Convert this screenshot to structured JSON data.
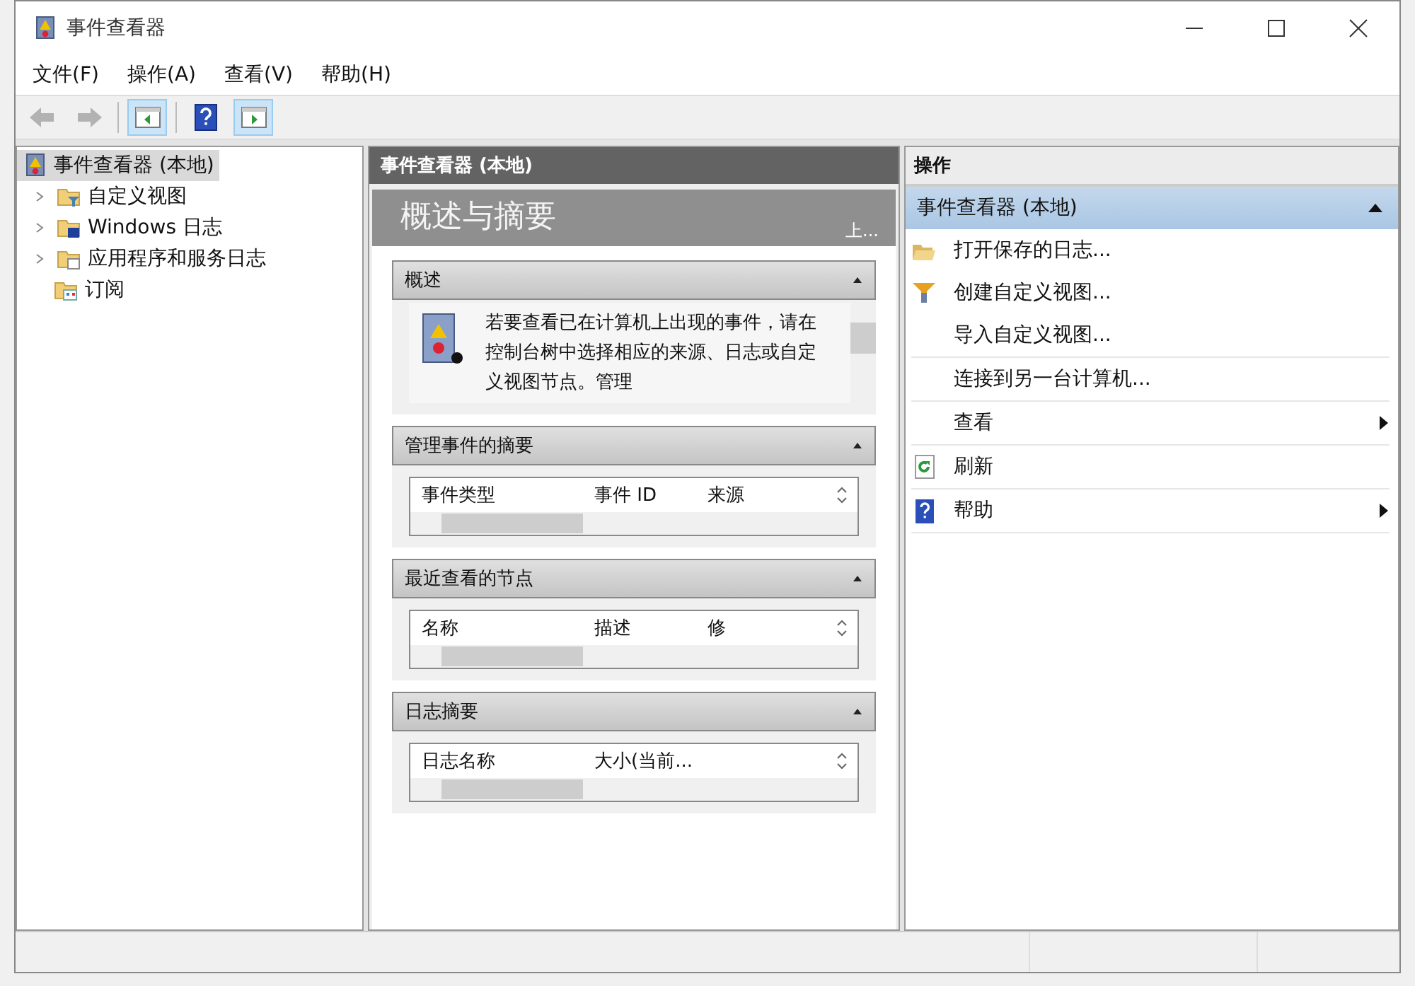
{
  "window": {
    "title": "事件查看器"
  },
  "menu": [
    {
      "label": "文件(F)"
    },
    {
      "label": "操作(A)"
    },
    {
      "label": "查看(V)"
    },
    {
      "label": "帮助(H)"
    }
  ],
  "toolbar": [
    {
      "kind": "back",
      "disabled": true,
      "pressed": false
    },
    {
      "kind": "forward",
      "disabled": true,
      "pressed": false
    },
    {
      "kind": "tree-pane",
      "disabled": false,
      "pressed": true
    },
    {
      "kind": "help",
      "disabled": false,
      "pressed": false
    },
    {
      "kind": "action-pane",
      "disabled": false,
      "pressed": true
    }
  ],
  "tree": [
    {
      "label": "事件查看器 (本地)",
      "kind": "viewer",
      "selected": true,
      "expanded": true,
      "children": [
        {
          "label": "自定义视图",
          "kind": "custom-views",
          "selected": false,
          "expanded": false
        },
        {
          "label": "Windows 日志",
          "kind": "windows-logs",
          "selected": false,
          "expanded": false
        },
        {
          "label": "应用程序和服务日志",
          "kind": "app-logs",
          "selected": false,
          "expanded": false
        },
        {
          "label": "订阅",
          "kind": "subscriptions",
          "selected": false
        }
      ]
    }
  ],
  "center": {
    "header": "事件查看器 (本地)",
    "title": "概述与摘要",
    "corner": "上...",
    "sections": [
      {
        "title": "概述",
        "kind": "text",
        "expanded": true,
        "text": "若要查看已在计算机上出现的事件，请在控制台树中选择相应的来源、日志或自定义视图节点。管理"
      },
      {
        "title": "管理事件的摘要",
        "kind": "table",
        "expanded": true,
        "columns": [
          "事件类型",
          "事件 ID",
          "来源"
        ]
      },
      {
        "title": "最近查看的节点",
        "kind": "table",
        "expanded": true,
        "columns": [
          "名称",
          "描述",
          "修"
        ]
      },
      {
        "title": "日志摘要",
        "kind": "table",
        "expanded": true,
        "columns": [
          "日志名称",
          "大小(当前..."
        ]
      }
    ]
  },
  "actions": {
    "header": "操作",
    "group": {
      "title": "事件查看器 (本地)",
      "expanded": true
    },
    "items": [
      [
        {
          "label": "打开保存的日志...",
          "kind": "open",
          "submenu": false
        },
        {
          "label": "创建自定义视图...",
          "kind": "create",
          "submenu": false
        },
        {
          "label": "导入自定义视图...",
          "kind": "import",
          "submenu": false
        }
      ],
      [
        {
          "label": "连接到另一台计算机...",
          "kind": "connect",
          "submenu": false
        }
      ],
      [
        {
          "label": "查看",
          "kind": "view",
          "submenu": true
        }
      ],
      [
        {
          "label": "刷新",
          "kind": "refresh",
          "submenu": false
        }
      ],
      [
        {
          "label": "帮助",
          "kind": "help",
          "submenu": true
        }
      ]
    ]
  }
}
